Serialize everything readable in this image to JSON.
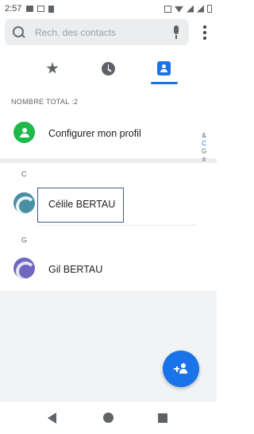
{
  "status_bar": {
    "time": "2:57",
    "left_icons": [
      "message-icon",
      "gmail-icon",
      "trash-icon"
    ],
    "right_icons": [
      "nfc-icon",
      "wifi-icon",
      "signal-icon",
      "signal-icon",
      "battery-icon"
    ]
  },
  "search": {
    "placeholder": "Rech. des contacts",
    "value": "",
    "icon": "search-icon",
    "mic_icon": "mic-icon",
    "more_icon": "more-vert-icon"
  },
  "tabs": [
    {
      "name": "favorites",
      "icon": "star-icon",
      "selected": false
    },
    {
      "name": "recent",
      "icon": "clock-icon",
      "selected": false
    },
    {
      "name": "contacts",
      "icon": "contact-card-icon",
      "selected": true
    }
  ],
  "total_label": "NOMBRE TOTAL :2",
  "profile": {
    "label": "Configurer mon profil",
    "icon": "person-icon"
  },
  "sections": [
    {
      "letter": "C",
      "contacts": [
        {
          "name": "Célile BERTAU",
          "highlighted": true
        }
      ]
    },
    {
      "letter": "G",
      "contacts": [
        {
          "name": "Gil BERTAU",
          "highlighted": false
        }
      ]
    }
  ],
  "alpha_index": [
    "&",
    "C",
    "G",
    "#"
  ],
  "fab": {
    "icon": "add-person-icon"
  },
  "nav_bar": [
    "back-icon",
    "home-icon",
    "recents-icon"
  ],
  "colors": {
    "accent": "#1a73e8",
    "profile_avatar": "#1fb84a",
    "avatar_c": "#4a8fa3",
    "avatar_g": "#6f67c0",
    "highlight_border": "#3b5b8f"
  }
}
